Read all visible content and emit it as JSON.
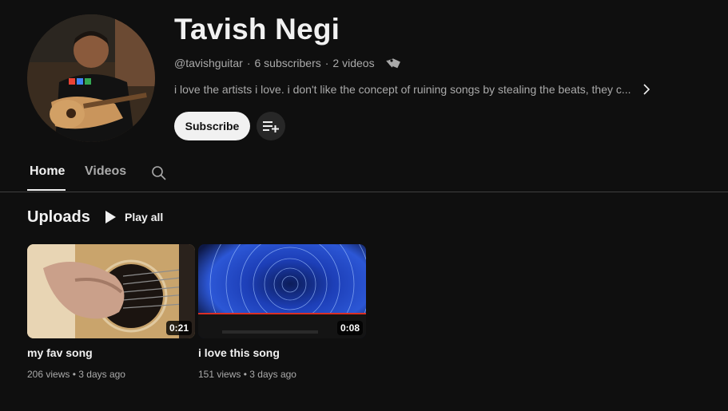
{
  "channel": {
    "name": "Tavish Negi",
    "handle": "@tavishguitar",
    "subscribers": "6 subscribers",
    "videos": "2 videos",
    "description": "i love the artists i love. i don't like the concept of ruining songs by stealing the beats, they c...",
    "subscribe_label": "Subscribe",
    "meta_sep": "·"
  },
  "tabs": [
    {
      "label": "Home",
      "active": true
    },
    {
      "label": "Videos",
      "active": false
    }
  ],
  "uploads": {
    "title": "Uploads",
    "play_all": "Play all",
    "videos": [
      {
        "title": "my fav song",
        "duration": "0:21",
        "views": "206 views",
        "age": "3 days ago"
      },
      {
        "title": "i love this song",
        "duration": "0:08",
        "views": "151 views",
        "age": "3 days ago"
      }
    ]
  },
  "colors": {
    "background": "#0f0f0f",
    "text_primary": "#f1f1f1",
    "text_secondary": "#aaaaaa",
    "button_bg": "#f1f1f1",
    "icon_button_bg": "#272727"
  },
  "icons": {
    "tag": "tag-icon",
    "chevron": "chevron-right-icon",
    "add_playlist": "playlist-add-icon",
    "search": "search-icon",
    "play": "play-icon"
  }
}
